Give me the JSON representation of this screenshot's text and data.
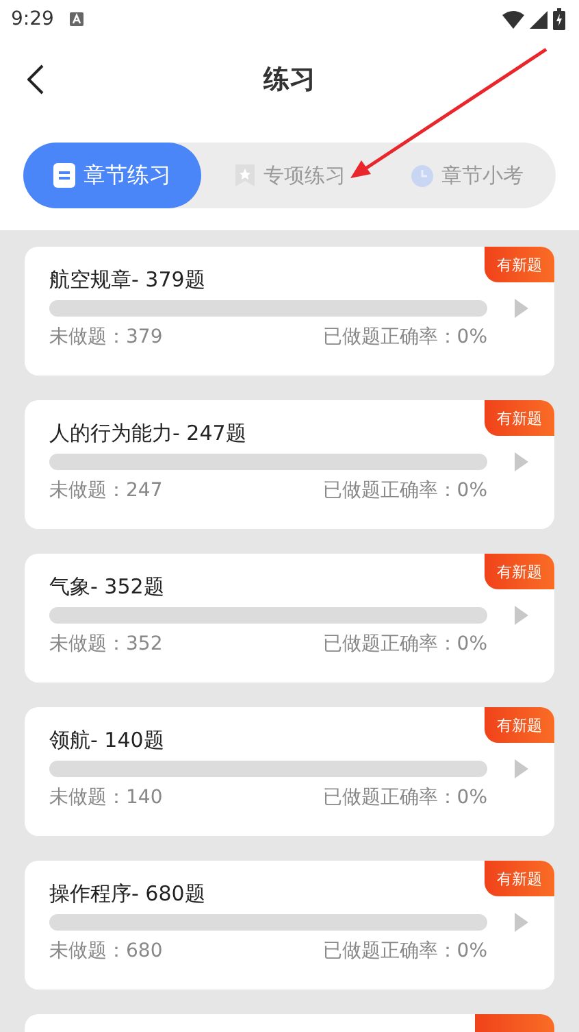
{
  "status_bar": {
    "time": "9:29"
  },
  "header": {
    "title": "练习"
  },
  "tabs": [
    {
      "label": "章节练习",
      "kind": "doc",
      "selected": true
    },
    {
      "label": "专项练习",
      "kind": "star",
      "selected": false
    },
    {
      "label": "章节小考",
      "kind": "clock",
      "selected": false
    }
  ],
  "chapters": [
    {
      "title": "航空规章- 379题",
      "badge": "有新题",
      "level": 0,
      "undone": "未做题：379",
      "accuracy": "已做题正确率：0%"
    },
    {
      "title": "人的行为能力- 247题",
      "badge": "有新题",
      "level": 0,
      "undone": "未做题：247",
      "accuracy": "已做题正确率：0%"
    },
    {
      "title": "气象- 352题",
      "badge": "有新题",
      "level": 0,
      "undone": "未做题：352",
      "accuracy": "已做题正确率：0%"
    },
    {
      "title": "领航- 140题",
      "badge": "有新题",
      "level": 0,
      "undone": "未做题：140",
      "accuracy": "已做题正确率：0%"
    },
    {
      "title": "操作程序- 680题",
      "badge": "有新题",
      "level": 0,
      "undone": "未做题：680",
      "accuracy": "已做题正确率：0%"
    }
  ]
}
